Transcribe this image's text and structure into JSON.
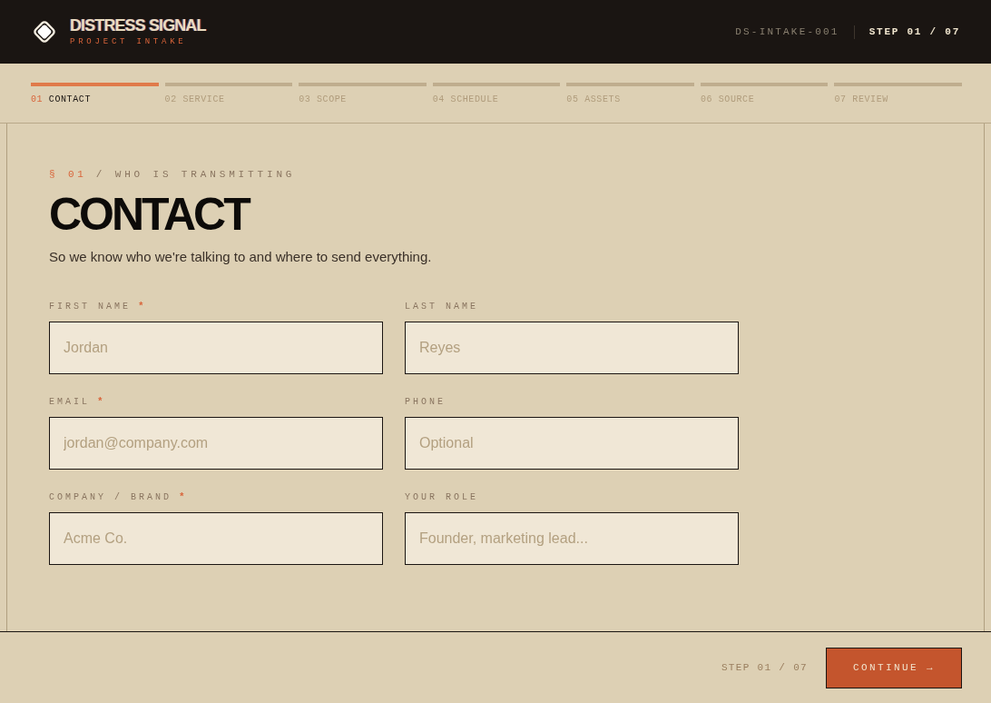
{
  "header": {
    "logo_title": "DISTRESS SIGNAL",
    "logo_subtitle": "PROJECT INTAKE",
    "reference": "DS-INTAKE-001",
    "step": "STEP 01 / 07"
  },
  "progress_steps": [
    {
      "number": "01",
      "label": "CONTACT",
      "selected": true
    },
    {
      "number": "02",
      "label": "SERVICE",
      "selected": false
    },
    {
      "number": "03",
      "label": "SCOPE",
      "selected": false
    },
    {
      "number": "04",
      "label": "SCHEDULE",
      "selected": false
    },
    {
      "number": "05",
      "label": "ASSETS",
      "selected": false
    },
    {
      "number": "06",
      "label": "SOURCE",
      "selected": false
    },
    {
      "number": "07",
      "label": "REVIEW",
      "selected": false
    }
  ],
  "section": {
    "marker": "§ 01",
    "kicker": "/ WHO IS TRANSMITTING",
    "title": "CONTACT",
    "description": "So we know who we're talking to and where to send everything."
  },
  "fields": [
    {
      "label": "FIRST NAME",
      "required_mark": "*",
      "placeholder": "Jordan"
    },
    {
      "label": "LAST NAME",
      "placeholder": "Reyes"
    },
    {
      "label": "EMAIL",
      "required_mark": "*",
      "placeholder": "jordan@company.com"
    },
    {
      "label": "PHONE",
      "placeholder": "Optional"
    },
    {
      "label": "COMPANY / BRAND",
      "required_mark": "*",
      "placeholder": "Acme Co."
    },
    {
      "label": "YOUR ROLE",
      "placeholder": "Founder, marketing lead..."
    }
  ],
  "footer": {
    "step": "STEP 01 / 07",
    "continue_button": "CONTINUE →"
  }
}
